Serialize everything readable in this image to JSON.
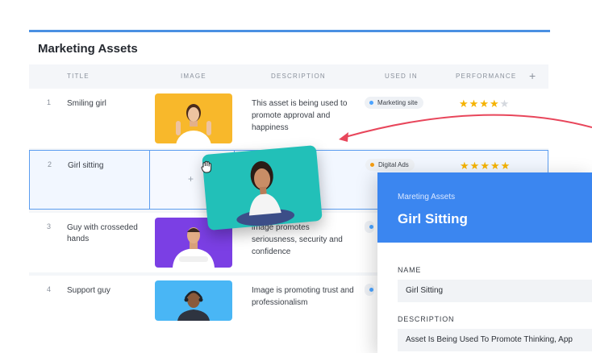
{
  "board": {
    "title": "Marketing Assets"
  },
  "columns": {
    "title": "TITLE",
    "image": "IMAGE",
    "description": "DESCRIPTION",
    "used_in": "USED IN",
    "performance": "PERFORMANCE",
    "add": "+"
  },
  "rows": [
    {
      "num": "1",
      "title": "Smiling girl",
      "description": "This asset is being used to promote approval and happiness",
      "used_in": "Marketing site",
      "used_in_color": "#4aa3ff",
      "rating": 4,
      "image_bg": "#f8b82b"
    },
    {
      "num": "2",
      "title": "Girl sitting",
      "description": "ed to",
      "used_in": "Digital Ads",
      "used_in_color": "#f39c12",
      "rating": 5,
      "image_bg": "#22c0b8"
    },
    {
      "num": "3",
      "title": "Guy with crosseded hands",
      "description": "image promotes seriousness, security and confidence",
      "used_in": "",
      "used_in_color": "#4aa3ff",
      "rating": 0,
      "image_bg": "#7b3fe4"
    },
    {
      "num": "4",
      "title": "Support guy",
      "description": "Image is promoting trust and professionalism",
      "used_in": "",
      "used_in_color": "#4aa3ff",
      "rating": 0,
      "image_bg": "#49b6f5"
    }
  ],
  "drop_target": {
    "plus": "+"
  },
  "panel": {
    "subtitle": "Mareting Assets",
    "title": "Girl Sitting",
    "name_label": "NAME",
    "name_value": "Girl Sitting",
    "description_label": "DESCRIPTION",
    "description_value": "Asset Is Being Used To Promote Thinking, App"
  },
  "colors": {
    "accent": "#3b86f0",
    "arrow": "#e8465b",
    "star": "#f5b301"
  },
  "icons": {
    "drag": "grab-hand-icon",
    "curved_arrow": "curved-arrow-icon",
    "star": "star-icon"
  }
}
